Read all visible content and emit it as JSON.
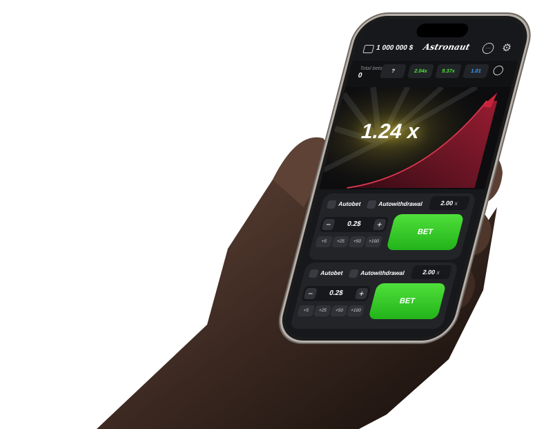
{
  "header": {
    "balance": "1 000 000 $",
    "logo": "Astronaut"
  },
  "stats": {
    "total_bets_label": "Total bets:",
    "total_bets_value": "0",
    "history": [
      {
        "value": "?",
        "color": "#ffffff"
      },
      {
        "value": "2.04x",
        "color": "#4fe03b"
      },
      {
        "value": "9.37x",
        "color": "#4fe03b"
      },
      {
        "value": "1.01",
        "color": "#3aa0ff"
      }
    ]
  },
  "game": {
    "multiplier": "1.24 x",
    "glow_color": "#ffe646",
    "curve_color": "#8e1a2e"
  },
  "panels": [
    {
      "autobet_label": "Autobet",
      "autowithdrawal_label": "Autowithdrawal",
      "cashout_value": "2.00",
      "cashout_unit": "x",
      "minus": "−",
      "plus": "+",
      "stake_value": "0.2$",
      "chips": [
        "+5",
        "+25",
        "+50",
        "+100"
      ],
      "bet_label": "BET"
    },
    {
      "autobet_label": "Autobet",
      "autowithdrawal_label": "Autowithdrawal",
      "cashout_value": "2.00",
      "cashout_unit": "x",
      "minus": "−",
      "plus": "+",
      "stake_value": "0.2$",
      "chips": [
        "+5",
        "+25",
        "+50",
        "+100"
      ],
      "bet_label": "BET"
    }
  ],
  "colors": {
    "accent_green": "#3ccf2a",
    "screen_bg": "#17181b",
    "panel_bg": "#232428"
  }
}
